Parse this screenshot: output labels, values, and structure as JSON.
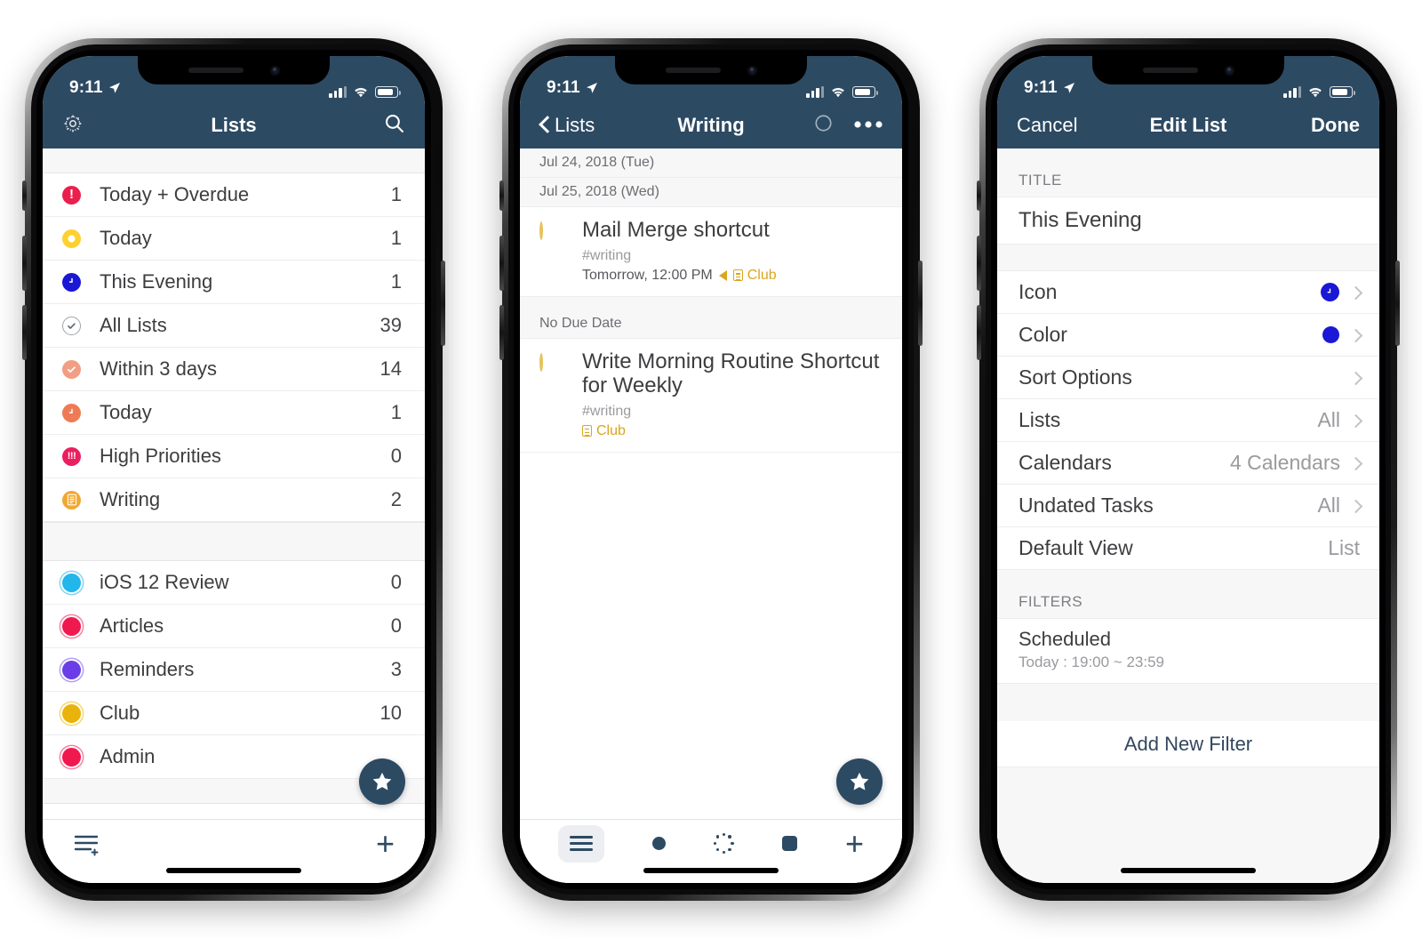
{
  "colors": {
    "navy": "#2d4a63",
    "red": "#eb1f4b",
    "yellow": "#ffd02e",
    "blue": "#1a17d6",
    "gray_check": "#9aa5ad",
    "salmon": "#f29e84",
    "salmon_dark": "#ef7b54",
    "pink": "#eb1f5e",
    "orange": "#f0a830",
    "cyan": "#22b6ea",
    "crimson": "#f0194f",
    "purple": "#6a3de8",
    "gold": "#e8b30c",
    "rose": "#f0194f",
    "task_ring": "#e6c35c",
    "tag_yellow": "#d9a61f"
  },
  "phone1": {
    "status": {
      "time": "9:11",
      "location_icon": "location-arrow-icon",
      "signal_icon": "cellular-bars-icon",
      "wifi_icon": "wifi-icon",
      "battery_icon": "battery-icon"
    },
    "nav": {
      "left_icon": "gear-icon",
      "title": "Lists",
      "right_icon": "search-icon"
    },
    "group1": [
      {
        "label": "Today + Overdue",
        "count": "1",
        "icon": "exclamation-circle-icon",
        "style": "bang",
        "color": "#eb1f4b"
      },
      {
        "label": "Today",
        "count": "1",
        "icon": "hollow-circle-icon",
        "style": "hollow",
        "color": "#ffd02e"
      },
      {
        "label": "This Evening",
        "count": "1",
        "icon": "clock-circle-icon",
        "style": "clock",
        "color": "#1a17d6"
      },
      {
        "label": "All Lists",
        "count": "39",
        "icon": "check-circle-outline-icon",
        "style": "checkOutline",
        "color": "#9aa5ad"
      },
      {
        "label": "Within 3 days",
        "count": "14",
        "icon": "check-circle-icon",
        "style": "check",
        "color": "#f29e84"
      },
      {
        "label": "Today",
        "count": "1",
        "icon": "clock-circle-icon",
        "style": "clock",
        "color": "#ef7b54"
      },
      {
        "label": "High Priorities",
        "count": "0",
        "icon": "triple-bang-circle-icon",
        "style": "bang3",
        "color": "#eb1f5e"
      },
      {
        "label": "Writing",
        "count": "2",
        "icon": "document-circle-icon",
        "style": "doc",
        "color": "#f0a830"
      }
    ],
    "group2": [
      {
        "label": "iOS 12 Review",
        "count": "0",
        "icon": "ring-circle-icon",
        "style": "ring",
        "color": "#22b6ea"
      },
      {
        "label": "Articles",
        "count": "0",
        "icon": "ring-circle-icon",
        "style": "ring",
        "color": "#f0194f"
      },
      {
        "label": "Reminders",
        "count": "3",
        "icon": "ring-circle-icon",
        "style": "ring",
        "color": "#6a3de8"
      },
      {
        "label": "Club",
        "count": "10",
        "icon": "ring-circle-icon",
        "style": "ring",
        "color": "#e8b30c"
      },
      {
        "label": "Admin",
        "count": "",
        "icon": "ring-circle-icon",
        "style": "ring",
        "color": "#f0194f"
      }
    ],
    "toolbar": {
      "left_icon": "add-list-icon",
      "right_icon": "plus-icon"
    },
    "fab_icon": "star-icon"
  },
  "phone2": {
    "status": {
      "time": "9:11"
    },
    "nav": {
      "back_label": "Lists",
      "title": "Writing",
      "circle_icon": "circle-icon",
      "more_icon": "more-dots-icon"
    },
    "sections": [
      {
        "header": "Jul 24, 2018 (Tue)",
        "tasks": []
      },
      {
        "header": "Jul 25, 2018 (Wed)",
        "tasks": [
          {
            "title": "Mail Merge shortcut",
            "tag": "#writing",
            "due": "Tomorrow, 12:00 PM",
            "alarm_icon": "alarm-icon",
            "list_icon": "document-icon",
            "list_name": "Club"
          }
        ]
      },
      {
        "header": "No Due Date",
        "tasks": [
          {
            "title": "Write Morning Routine Shortcut for Weekly",
            "tag": "#writing",
            "due": "",
            "list_icon": "document-icon",
            "list_name": "Club"
          }
        ]
      }
    ],
    "tabs": [
      {
        "name": "list-tab",
        "icon": "hamburger-icon",
        "active": true
      },
      {
        "name": "dot-tab",
        "icon": "filled-dot-icon",
        "active": false
      },
      {
        "name": "progress-tab",
        "icon": "dotted-ring-icon",
        "active": false
      },
      {
        "name": "square-tab",
        "icon": "filled-square-icon",
        "active": false
      },
      {
        "name": "add-tab",
        "icon": "plus-icon",
        "active": false
      }
    ],
    "fab_icon": "star-icon"
  },
  "phone3": {
    "status": {
      "time": "9:11"
    },
    "nav": {
      "cancel": "Cancel",
      "title": "Edit List",
      "done": "Done"
    },
    "title_section": {
      "label": "TITLE",
      "value": "This Evening"
    },
    "settings": [
      {
        "label": "Icon",
        "value": "",
        "accessory": "clock-swatch",
        "chevron": true
      },
      {
        "label": "Color",
        "value": "",
        "accessory": "color-swatch",
        "chevron": true
      },
      {
        "label": "Sort Options",
        "value": "",
        "accessory": "none",
        "chevron": true
      },
      {
        "label": "Lists",
        "value": "All",
        "accessory": "none",
        "chevron": true
      },
      {
        "label": "Calendars",
        "value": "4 Calendars",
        "accessory": "none",
        "chevron": true
      },
      {
        "label": "Undated Tasks",
        "value": "All",
        "accessory": "none",
        "chevron": true
      },
      {
        "label": "Default View",
        "value": "List",
        "accessory": "none",
        "chevron": false
      }
    ],
    "filters_section": {
      "label": "FILTERS",
      "items": [
        {
          "title": "Scheduled",
          "subtitle": "Today : 19:00 ~ 23:59"
        }
      ],
      "add_label": "Add New Filter"
    }
  }
}
